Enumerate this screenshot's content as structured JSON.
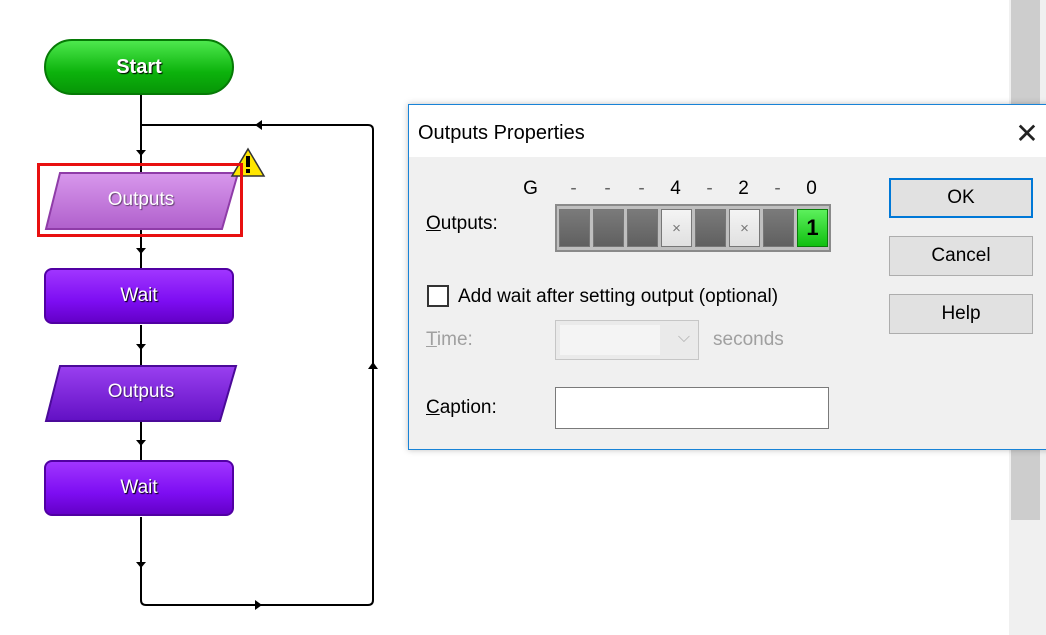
{
  "flowchart": {
    "start_label": "Start",
    "nodes": [
      {
        "type": "outputs",
        "label": "Outputs",
        "selected": true
      },
      {
        "type": "wait",
        "label": "Wait"
      },
      {
        "type": "outputs",
        "label": "Outputs"
      },
      {
        "type": "wait",
        "label": "Wait"
      }
    ],
    "warning_icon": "warning-icon"
  },
  "dialog": {
    "title": "Outputs Properties",
    "close_icon": "close-icon",
    "bit_headers": [
      "G",
      "-",
      "-",
      "-",
      "4",
      "-",
      "2",
      "-",
      "0"
    ],
    "outputs_label": "Outputs:",
    "bits": [
      {
        "state": "off",
        "text": ""
      },
      {
        "state": "off",
        "text": ""
      },
      {
        "state": "off",
        "text": ""
      },
      {
        "state": "x",
        "text": "×"
      },
      {
        "state": "off",
        "text": ""
      },
      {
        "state": "x",
        "text": "×"
      },
      {
        "state": "off",
        "text": ""
      },
      {
        "state": "on",
        "text": "1"
      }
    ],
    "add_wait_label": "Add wait after setting output (optional)",
    "time_label": "Time:",
    "time_value": "",
    "seconds_label": "seconds",
    "caption_label": "Caption:",
    "caption_value": "",
    "ok_label": "OK",
    "cancel_label": "Cancel",
    "help_label": "Help"
  },
  "colors": {
    "start": "#0cb30c",
    "wait": "#7d0df2",
    "outputs_selected": "#c070d8",
    "outputs": "#7a1ed6",
    "selection": "#e81010",
    "accent": "#0078d7",
    "bit_on": "#10c010"
  }
}
